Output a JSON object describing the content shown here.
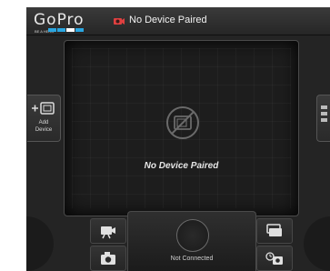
{
  "app": {
    "logo_text": "GoPro",
    "logo_subtext": "BE A HERO",
    "logo_colors": [
      "#2aa6e0",
      "#2aa6e0",
      "#ffffff",
      "#2aa6e0"
    ]
  },
  "status": {
    "text": "No Device Paired",
    "icon": "camera-disconnected-icon",
    "icon_color": "#e04040"
  },
  "panel": {
    "message": "No Device Paired",
    "icon": "no-device-icon"
  },
  "sidebar_left": {
    "add_device_label": "Add\nDevice",
    "icon": "add-camera-icon"
  },
  "sidebar_right": {
    "icon": "settings-list-icon"
  },
  "controls": {
    "shutter_label": "Not Connected",
    "video_mode_icon": "video-camera-icon",
    "photo_mode_icon": "photo-camera-icon",
    "burst_mode_icon": "burst-mode-icon",
    "timelapse_mode_icon": "timelapse-camera-icon"
  }
}
